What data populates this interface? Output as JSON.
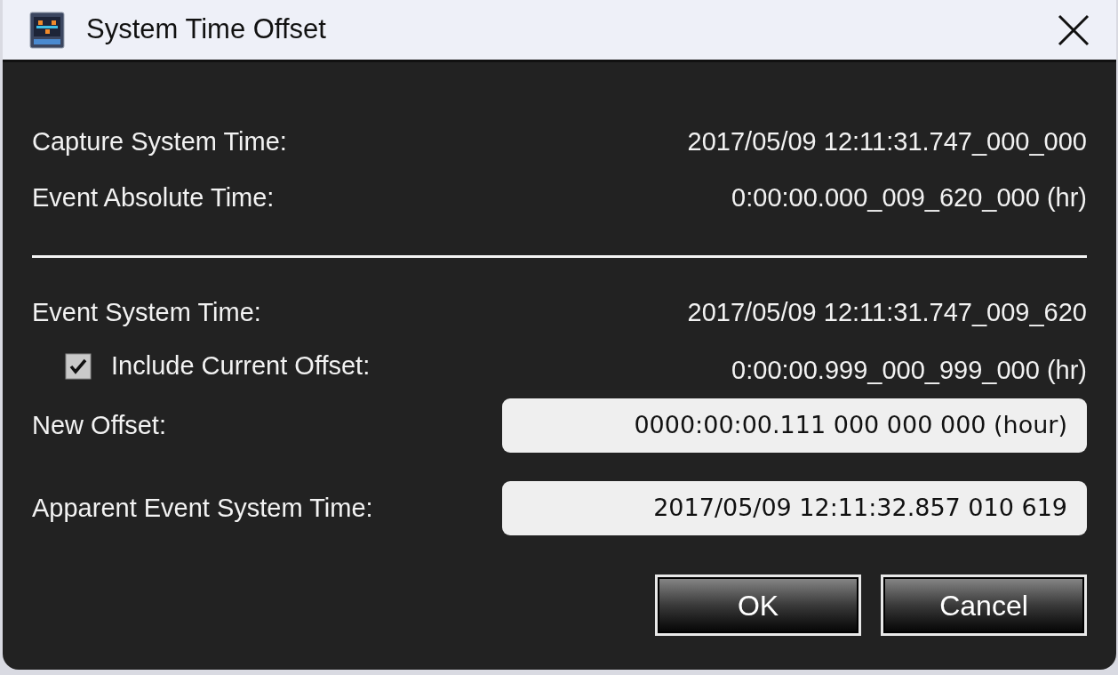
{
  "window": {
    "title": "System Time Offset"
  },
  "info_rows": [
    {
      "label": "Capture System Time:",
      "value": "2017/05/09 12:11:31.747_000_000"
    },
    {
      "label": "Event Absolute Time:",
      "value": "0:00:00.000_009_620_000 (hr)"
    }
  ],
  "event_rows": [
    {
      "kind": "text",
      "label": "Event System Time:",
      "value": "2017/05/09 12:11:31.747_009_620"
    },
    {
      "kind": "checkbox",
      "label": "Include Current Offset:",
      "checked": true,
      "value": "0:00:00.999_000_999_000 (hr)"
    },
    {
      "kind": "field",
      "label": "New Offset:",
      "value": "0000:00:00.111 000 000 000 (hour)"
    },
    {
      "kind": "field",
      "label": "Apparent Event System Time:",
      "value": "2017/05/09 12:11:32.857 010 619"
    }
  ],
  "buttons": [
    {
      "label": "OK"
    },
    {
      "label": "Cancel"
    }
  ]
}
